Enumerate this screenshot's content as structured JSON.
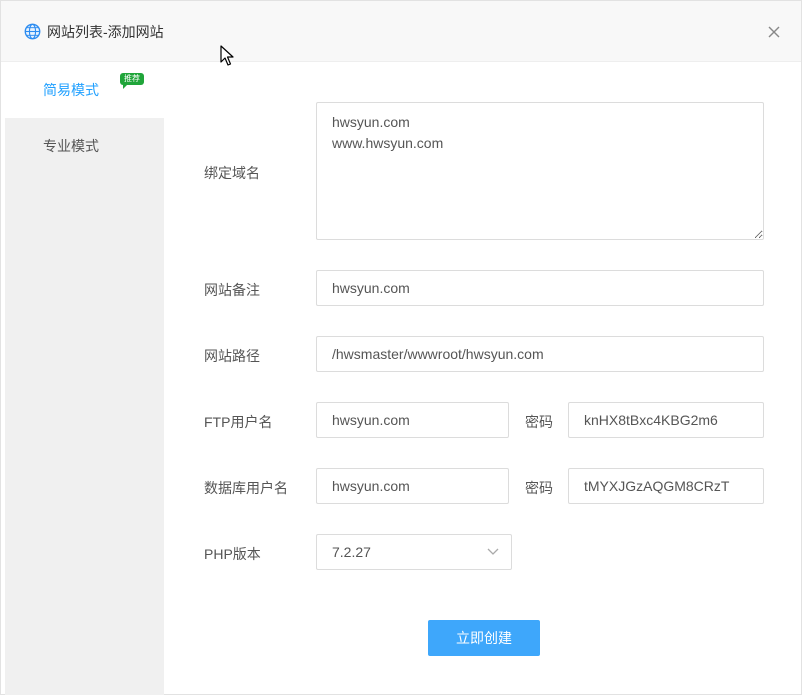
{
  "dialog": {
    "title": "网站列表-添加网站",
    "icon": "globe-icon",
    "close_icon": "close-icon"
  },
  "sidebar": {
    "items": [
      {
        "label": "简易模式",
        "badge": "推荐",
        "active": true
      },
      {
        "label": "专业模式",
        "active": false
      }
    ]
  },
  "form": {
    "domain": {
      "label": "绑定域名",
      "value": "hwsyun.com\nwww.hwsyun.com"
    },
    "remark": {
      "label": "网站备注",
      "value": "hwsyun.com"
    },
    "path": {
      "label": "网站路径",
      "value": "/hwsmaster/wwwroot/hwsyun.com"
    },
    "ftp": {
      "label": "FTP用户名",
      "user": "hwsyun.com",
      "password_label": "密码",
      "password": "knHX8tBxc4KBG2m6"
    },
    "db": {
      "label": "数据库用户名",
      "user": "hwsyun.com",
      "password_label": "密码",
      "password": "tMYXJGzAQGM8CRzT"
    },
    "php": {
      "label": "PHP版本",
      "selected": "7.2.27"
    },
    "submit_label": "立即创建"
  },
  "colors": {
    "accent": "#20a0ff",
    "button": "#3ea7fb",
    "badge": "#20a53a"
  }
}
